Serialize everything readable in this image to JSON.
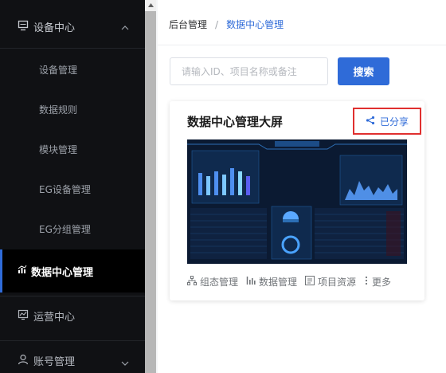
{
  "sidebar": {
    "device_center": "设备中心",
    "items": [
      {
        "label": "设备管理"
      },
      {
        "label": "数据规则"
      },
      {
        "label": "模块管理"
      },
      {
        "label": "EG设备管理"
      },
      {
        "label": "EG分组管理"
      }
    ],
    "active": "数据中心管理",
    "ops_center": "运营中心",
    "account": "账号管理"
  },
  "breadcrumb": {
    "root": "后台管理",
    "sep": "/",
    "current": "数据中心管理"
  },
  "search": {
    "placeholder": "请输入ID、项目名称或备注",
    "button": "搜索"
  },
  "card": {
    "title": "数据中心管理大屏",
    "shared": "已分享",
    "actions": [
      {
        "label": "组态管理",
        "icon": "sitemap-icon"
      },
      {
        "label": "数据管理",
        "icon": "chart-icon"
      },
      {
        "label": "项目资源",
        "icon": "list-icon"
      },
      {
        "label": "更多",
        "icon": "more-icon"
      }
    ]
  },
  "colors": {
    "accent": "#2f6bd8",
    "sidebar_bg": "#101114",
    "highlight_border": "#e0302f"
  }
}
